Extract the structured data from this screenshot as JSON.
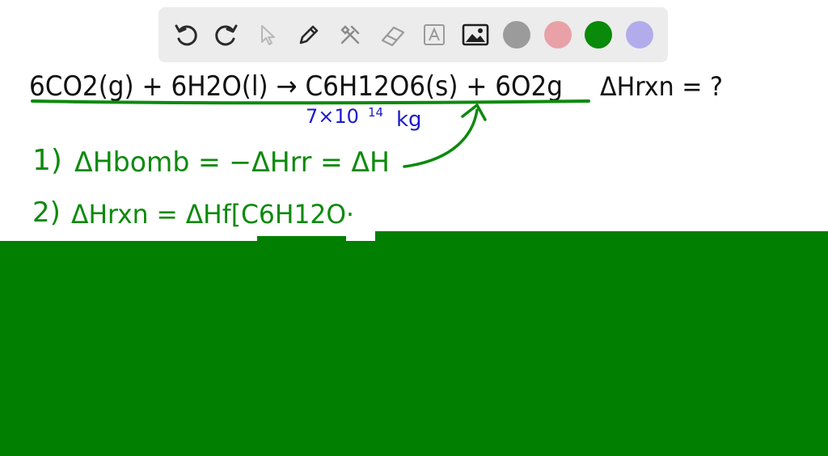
{
  "toolbar": {
    "tools": [
      {
        "name": "undo-icon"
      },
      {
        "name": "redo-icon"
      },
      {
        "name": "select-pointer-icon"
      },
      {
        "name": "pen-icon"
      },
      {
        "name": "tools-icon"
      },
      {
        "name": "eraser-icon"
      },
      {
        "name": "text-box-icon"
      },
      {
        "name": "image-icon"
      }
    ],
    "colors": [
      "#9b9b9b",
      "#e8a1a6",
      "#0a8a0a",
      "#b3acec"
    ]
  },
  "whiteboard": {
    "equation": "6CO2(g) + 6H2O(l) → C6H12O6(s) + 6O2g",
    "question": "ΔHrxn = ?",
    "mass_note": "7×10",
    "mass_exp": "14",
    "mass_unit": "kg",
    "step1_num": "1)",
    "step1": "ΔHbomb = −ΔHrr = ΔH",
    "step2_num": "2)",
    "step2": "ΔHrxn = ΔHf[C6H12O·"
  },
  "colors": {
    "ink_black": "#111111",
    "ink_green": "#0d8a0d",
    "ink_blue": "#1a1acc",
    "overlay_green": "#007f00"
  }
}
